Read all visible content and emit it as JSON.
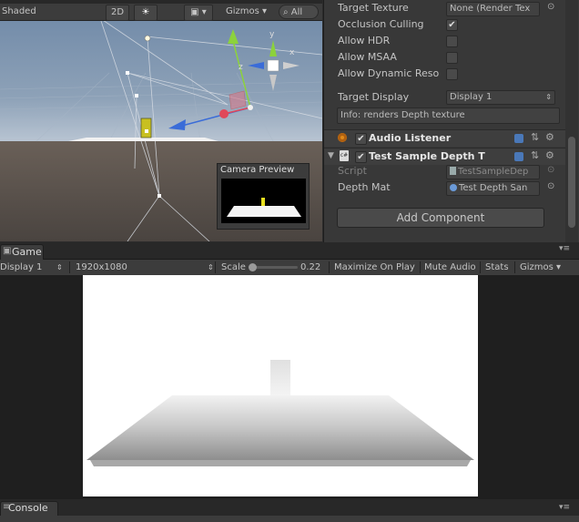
{
  "scene": {
    "shading_mode": "Shaded",
    "mode_2d": "2D",
    "gizmos_label": "Gizmos",
    "search_placeholder": "All",
    "camera_preview_title": "Camera Preview",
    "axis_y": "y",
    "axis_x": "x",
    "axis_z": "z"
  },
  "inspector": {
    "target_texture_label": "Target Texture",
    "target_texture_value": "None (Render Tex",
    "occlusion_culling_label": "Occlusion Culling",
    "occlusion_culling_check": "✔",
    "allow_hdr_label": "Allow HDR",
    "allow_msaa_label": "Allow MSAA",
    "allow_dynamic_label": "Allow Dynamic Reso",
    "target_display_label": "Target Display",
    "target_display_value": "Display 1",
    "info_text": "Info: renders Depth texture",
    "audio_listener_title": "Audio Listener",
    "audio_check": "✔",
    "test_sample_title": "Test Sample Depth T",
    "test_sample_check": "✔",
    "script_label": "Script",
    "script_value": "TestSampleDep",
    "depth_mat_label": "Depth Mat",
    "depth_mat_value": "Test Depth San",
    "add_component_label": "Add Component",
    "cs_badge": "c#"
  },
  "game": {
    "tab_label": "Game",
    "display": "Display 1",
    "resolution": "1920x1080",
    "scale_label": "Scale",
    "scale_value": "0.22",
    "scale_fraction": 0.0,
    "maximize_label": "Maximize On Play",
    "mute_label": "Mute Audio",
    "stats_label": "Stats",
    "gizmos_label": "Gizmos"
  },
  "console": {
    "tab_label": "Console"
  },
  "colors": {
    "editor_bg": "#383838",
    "sky": "#5f7a9a",
    "ground": "#4e4843",
    "game_bg": "#ffffff",
    "gizmo_y": "#8cd23c",
    "gizmo_x": "#e0485a",
    "gizmo_z": "#3a6cd8"
  }
}
